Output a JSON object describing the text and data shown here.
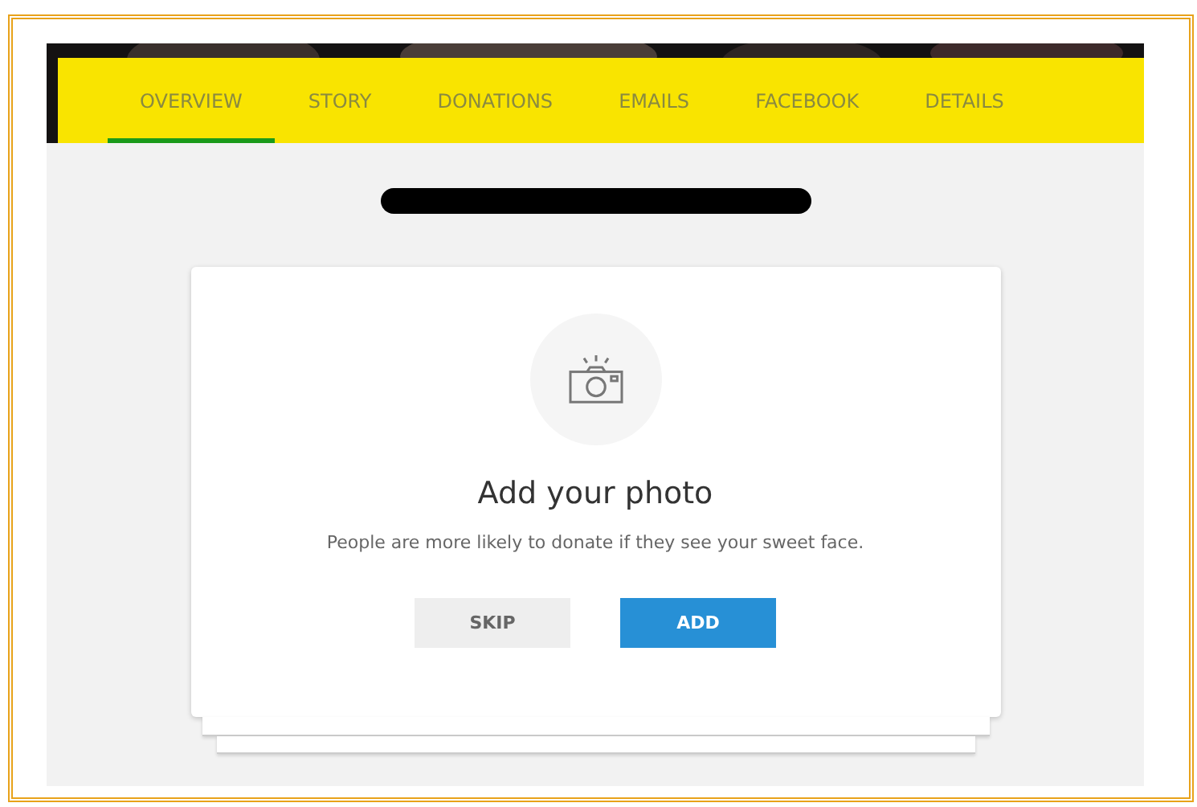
{
  "tabs": [
    {
      "label": "OVERVIEW",
      "selected": true
    },
    {
      "label": "STORY",
      "selected": false
    },
    {
      "label": "DONATIONS",
      "selected": false
    },
    {
      "label": "EMAILS",
      "selected": false
    },
    {
      "label": "FACEBOOK",
      "selected": false
    },
    {
      "label": "DETAILS",
      "selected": false
    }
  ],
  "photo_card": {
    "title": "Add your photo",
    "message": "People are more likely to donate if they see your sweet face.",
    "buttons": [
      {
        "label": "SKIP",
        "kind": "secondary"
      },
      {
        "label": "ADD",
        "kind": "primary"
      }
    ]
  }
}
